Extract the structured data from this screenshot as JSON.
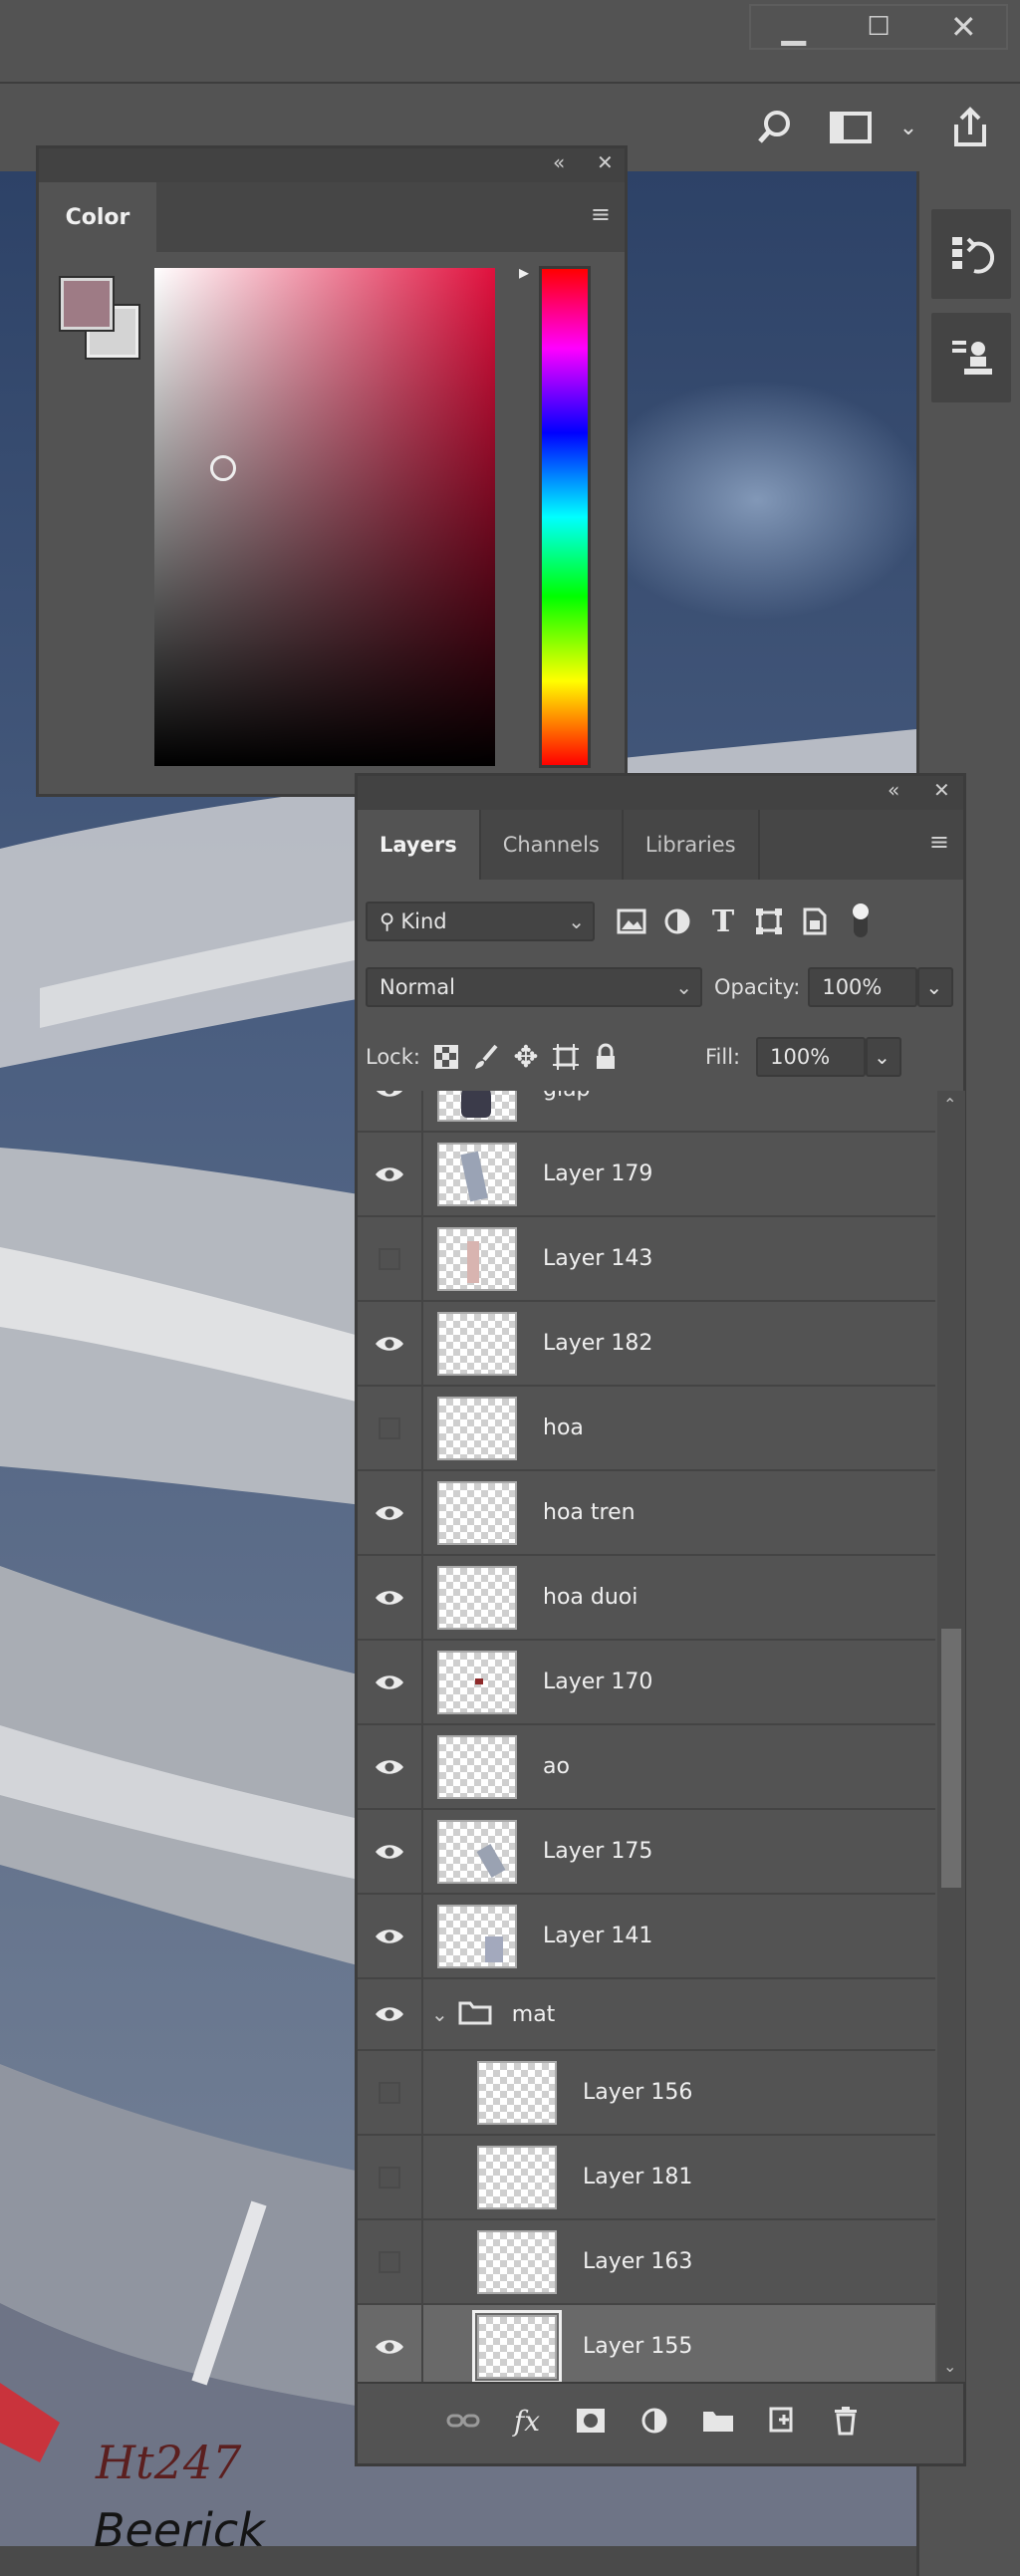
{
  "window": {
    "minimize": "▁",
    "restore": "☐",
    "close": "✕"
  },
  "color_panel": {
    "tab_label": "Color",
    "foreground_color": "#9e7b85",
    "background_color": "#d4d4d4",
    "hue_color": "#e0103d"
  },
  "layers_panel": {
    "tabs": [
      "Layers",
      "Channels",
      "Libraries"
    ],
    "filter_kind": "Kind",
    "blend_mode": "Normal",
    "opacity_label": "Opacity:",
    "opacity_value": "100%",
    "lock_label": "Lock:",
    "fill_label": "Fill:",
    "fill_value": "100%",
    "layers": [
      {
        "name": "giap",
        "visible": true
      },
      {
        "name": "Layer 179",
        "visible": true
      },
      {
        "name": "Layer 143",
        "visible": false
      },
      {
        "name": "Layer 182",
        "visible": true
      },
      {
        "name": "hoa",
        "visible": false
      },
      {
        "name": "hoa tren",
        "visible": true
      },
      {
        "name": "hoa duoi",
        "visible": true
      },
      {
        "name": "Layer 170",
        "visible": true
      },
      {
        "name": "ao",
        "visible": true
      },
      {
        "name": "Layer 175",
        "visible": true
      },
      {
        "name": "Layer 141",
        "visible": true
      },
      {
        "name": "mat",
        "visible": true,
        "group": true
      },
      {
        "name": "Layer 156",
        "visible": false,
        "child": true
      },
      {
        "name": "Layer 181",
        "visible": false,
        "child": true
      },
      {
        "name": "Layer 163",
        "visible": false,
        "child": true
      },
      {
        "name": "Layer 155",
        "visible": true,
        "child": true,
        "selected": true
      }
    ]
  },
  "signature": {
    "line1": "Ht247",
    "line2": "Beerick"
  }
}
